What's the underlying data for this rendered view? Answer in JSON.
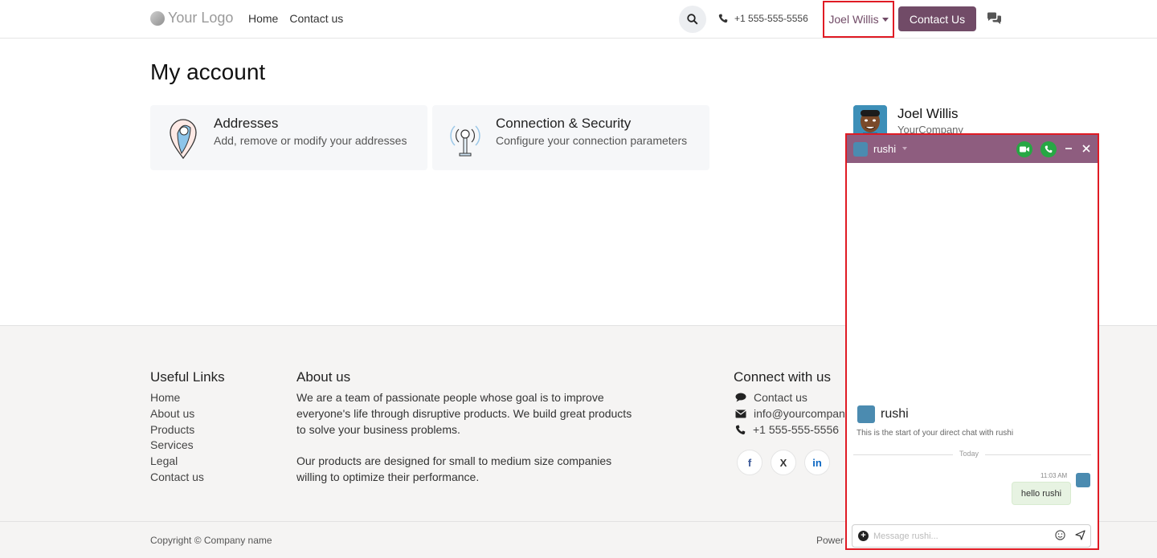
{
  "header": {
    "logo_text": "Your Logo",
    "nav": [
      "Home",
      "Contact us"
    ],
    "phone": "+1 555-555-5556",
    "user_name": "Joel Willis",
    "contact_button": "Contact Us"
  },
  "main": {
    "title": "My account",
    "cards": [
      {
        "title": "Addresses",
        "desc": "Add, remove or modify your addresses"
      },
      {
        "title": "Connection & Security",
        "desc": "Configure your connection parameters"
      }
    ],
    "profile": {
      "name": "Joel Willis",
      "company": "YourCompany"
    }
  },
  "footer": {
    "useful_links_title": "Useful Links",
    "useful_links": [
      "Home",
      "About us",
      "Products",
      "Services",
      "Legal",
      "Contact us"
    ],
    "about_title": "About us",
    "about_p1_lines": [
      "We are a team of passionate people whose goal is to improve",
      "everyone's life through disruptive products. We build great products",
      "to solve your business problems."
    ],
    "about_p2_lines": [
      "Our products are designed for small to medium size companies",
      "willing to optimize their performance."
    ],
    "connect_title": "Connect with us",
    "connect_items": [
      "Contact us",
      "info@yourcompan",
      "+1 555-555-5556"
    ],
    "social": [
      "f",
      "X",
      "in"
    ],
    "copyright": "Copyright © Company name",
    "powered": "Power"
  },
  "chat": {
    "name": "rushi",
    "intro_name": "rushi",
    "intro_text": "This is the start of your direct chat with rushi",
    "today_label": "Today",
    "message_time": "11:03 AM",
    "message_text": "hello rushi",
    "composer_placeholder": "Message rushi..."
  },
  "colors": {
    "brand": "#714B67",
    "chat_header": "#8e5d7f",
    "call_green": "#27a744",
    "highlight_red": "#e01b24"
  },
  "icons": [
    "search-icon",
    "phone-icon",
    "chat-bubbles-icon",
    "location-pin-icon",
    "antenna-icon",
    "video-call-icon",
    "phone-call-icon",
    "minimize-icon",
    "close-icon",
    "comment-icon",
    "envelope-icon",
    "plus-icon",
    "emoji-icon",
    "send-icon"
  ]
}
